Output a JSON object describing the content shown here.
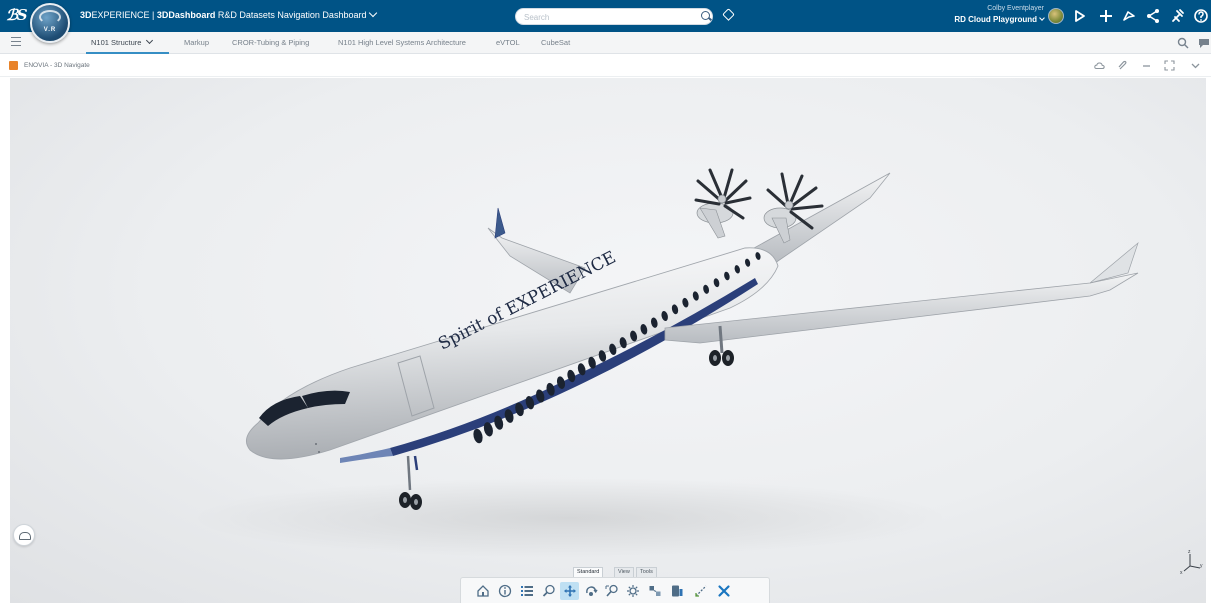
{
  "topbar": {
    "brand_prefix": "3D",
    "brand_mid": "EXPERIENCE | ",
    "brand_app": "3DDashboard",
    "dashboard_name": " R&D Datasets Navigation Dashboard",
    "compass_label": "V.R",
    "search_placeholder": "Search",
    "user_name": "Colby Eventplayer",
    "tenant": "RD Cloud Playground",
    "icons": [
      "ds-logo",
      "compass-icon",
      "search-icon",
      "tag-icon",
      "avatar",
      "share-icon",
      "add-icon",
      "collaborate-icon",
      "share-network-icon",
      "tools-icon",
      "help-icon"
    ]
  },
  "tabs": {
    "items": [
      {
        "label": "N101 Structure",
        "active": true
      },
      {
        "label": "Markup",
        "active": false
      },
      {
        "label": "CROR-Tubing & Piping",
        "active": false
      },
      {
        "label": "N101 High Level Systems Architecture",
        "active": false
      },
      {
        "label": "eVTOL",
        "active": false
      },
      {
        "label": "CubeSat",
        "active": false
      }
    ]
  },
  "widget": {
    "title": "ENOVIA - 3D Navigate",
    "header_icons": [
      "cloud-icon",
      "pin-icon",
      "minimize-icon",
      "maximize-icon",
      "chevron-down-icon"
    ]
  },
  "model": {
    "livery_text": "Spirit of EXPERIENCE",
    "colors": {
      "fuselage": "#e9ebed",
      "stripe": "#2b3f7a",
      "windows": "#1b2330",
      "background": "#eceef0"
    }
  },
  "axis": {
    "z_label": "z",
    "y_label": "y",
    "x_label": "x"
  },
  "action_bar": {
    "tabs": [
      {
        "label": "Standard",
        "active": true
      },
      {
        "label": "View",
        "active": false
      },
      {
        "label": "Tools",
        "active": false
      }
    ],
    "buttons": [
      "home-view-icon",
      "info-icon",
      "tree-list-icon",
      "zoom-icon",
      "pan-icon",
      "rotate-icon",
      "zoom-area-icon",
      "fit-all-icon",
      "explode-icon",
      "section-icon",
      "measure-icon",
      "close-icon"
    ]
  },
  "theme": {
    "brand_blue": "#005386",
    "accent": "#368ec4",
    "orange": "#e8832a"
  }
}
